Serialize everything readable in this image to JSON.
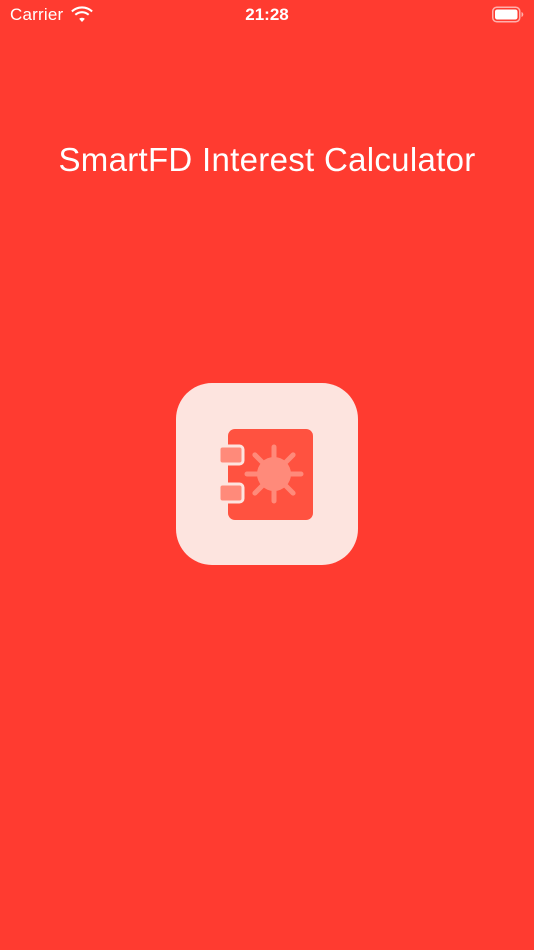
{
  "status_bar": {
    "carrier": "Carrier",
    "time": "21:28",
    "wifi_icon": "wifi-icon",
    "battery_icon": "battery-icon"
  },
  "splash": {
    "title": "SmartFD Interest Calculator",
    "app_icon": "safe-vault-icon"
  },
  "colors": {
    "background": "#ff3b30",
    "icon_tile": "#fde4df",
    "icon_primary": "#ff5240",
    "icon_accent": "#ff8a7a"
  }
}
